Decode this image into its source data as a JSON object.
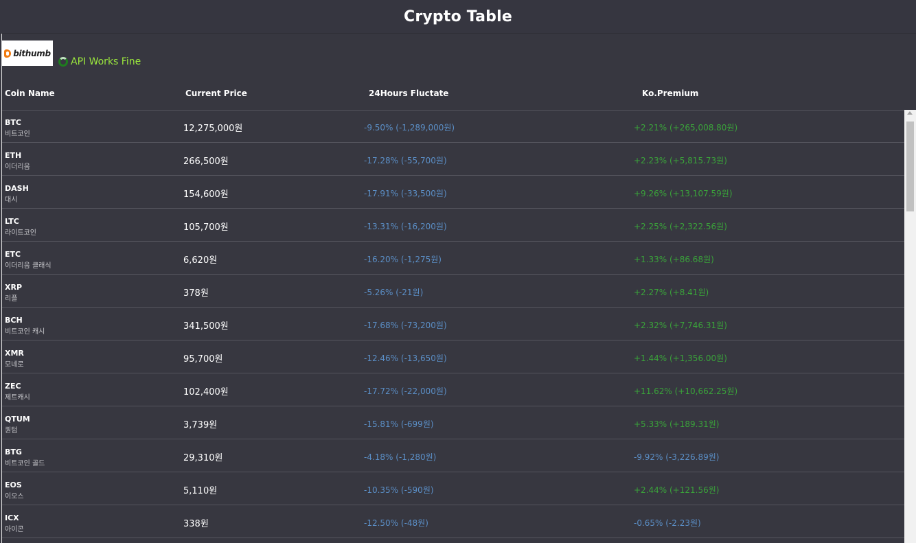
{
  "header": {
    "title": "Crypto Table"
  },
  "brand": {
    "logo_text": "bithumb",
    "api_status": "API Works Fine"
  },
  "columns": {
    "coin_name": "Coin Name",
    "current_price": "Current Price",
    "fluctuate": "24Hours Fluctate",
    "premium": "Ko.Premium"
  },
  "rows": [
    {
      "symbol": "BTC",
      "korean": "비트코인",
      "price": "12,275,000원",
      "fluct": "-9.50% (-1,289,000원)",
      "premium": "+2.21% (+265,008.80원)",
      "premium_sign": "pos"
    },
    {
      "symbol": "ETH",
      "korean": "이더리움",
      "price": "266,500원",
      "fluct": "-17.28% (-55,700원)",
      "premium": "+2.23% (+5,815.73원)",
      "premium_sign": "pos"
    },
    {
      "symbol": "DASH",
      "korean": "대시",
      "price": "154,600원",
      "fluct": "-17.91% (-33,500원)",
      "premium": "+9.26% (+13,107.59원)",
      "premium_sign": "pos"
    },
    {
      "symbol": "LTC",
      "korean": "라이트코인",
      "price": "105,700원",
      "fluct": "-13.31% (-16,200원)",
      "premium": "+2.25% (+2,322.56원)",
      "premium_sign": "pos"
    },
    {
      "symbol": "ETC",
      "korean": "이더리움 클래식",
      "price": "6,620원",
      "fluct": "-16.20% (-1,275원)",
      "premium": "+1.33% (+86.68원)",
      "premium_sign": "pos"
    },
    {
      "symbol": "XRP",
      "korean": "리플",
      "price": "378원",
      "fluct": "-5.26% (-21원)",
      "premium": "+2.27% (+8.41원)",
      "premium_sign": "pos"
    },
    {
      "symbol": "BCH",
      "korean": "비트코인 캐시",
      "price": "341,500원",
      "fluct": "-17.68% (-73,200원)",
      "premium": "+2.32% (+7,746.31원)",
      "premium_sign": "pos"
    },
    {
      "symbol": "XMR",
      "korean": "모네로",
      "price": "95,700원",
      "fluct": "-12.46% (-13,650원)",
      "premium": "+1.44% (+1,356.00원)",
      "premium_sign": "pos"
    },
    {
      "symbol": "ZEC",
      "korean": "제트캐시",
      "price": "102,400원",
      "fluct": "-17.72% (-22,000원)",
      "premium": "+11.62% (+10,662.25원)",
      "premium_sign": "pos"
    },
    {
      "symbol": "QTUM",
      "korean": "퀀텀",
      "price": "3,739원",
      "fluct": "-15.81% (-699원)",
      "premium": "+5.33% (+189.31원)",
      "premium_sign": "pos"
    },
    {
      "symbol": "BTG",
      "korean": "비트코인 골드",
      "price": "29,310원",
      "fluct": "-4.18% (-1,280원)",
      "premium": "-9.92% (-3,226.89원)",
      "premium_sign": "neg"
    },
    {
      "symbol": "EOS",
      "korean": "이오스",
      "price": "5,110원",
      "fluct": "-10.35% (-590원)",
      "premium": "+2.44% (+121.56원)",
      "premium_sign": "pos"
    },
    {
      "symbol": "ICX",
      "korean": "아이콘",
      "price": "338원",
      "fluct": "-12.50% (-48원)",
      "premium": "-0.65% (-2.23원)",
      "premium_sign": "neg"
    }
  ],
  "colors": {
    "background": "#373740",
    "api_ok": "#9be83d",
    "fluct": "#5b8fc7",
    "premium_pos": "#3aa33a",
    "premium_neg": "#5b8fc7"
  }
}
